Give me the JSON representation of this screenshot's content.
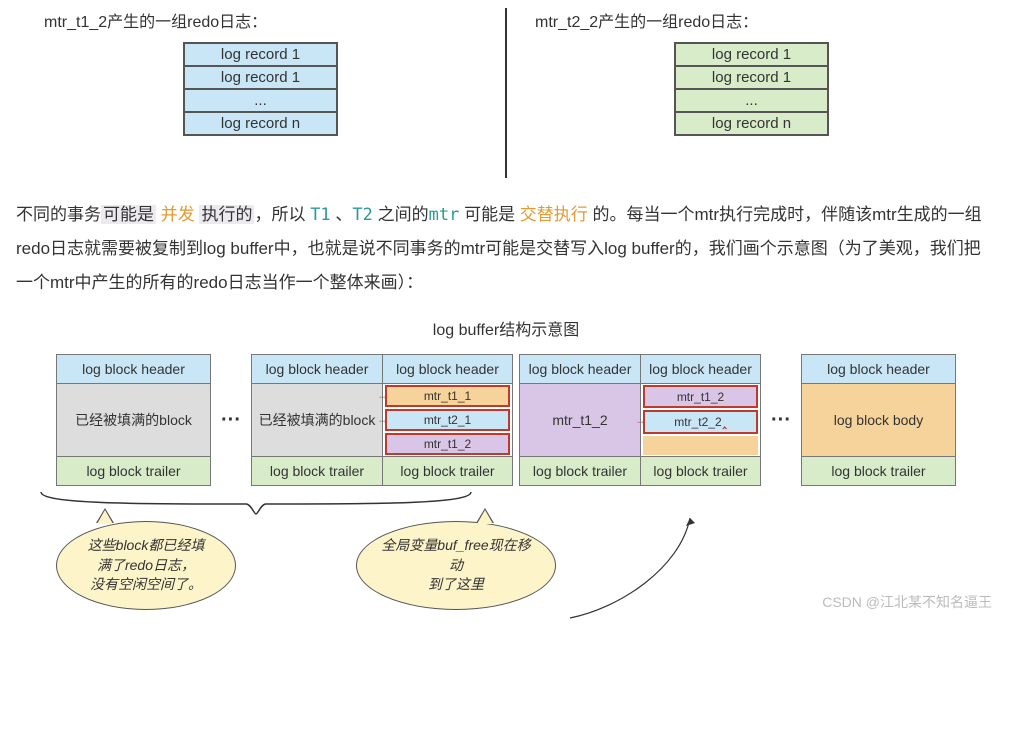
{
  "top": {
    "left_title": "mtr_t1_2产生的一组redo日志：",
    "right_title": "mtr_t2_2产生的一组redo日志：",
    "rows": [
      "log record 1",
      "log record 1",
      "...",
      "log record n"
    ]
  },
  "paragraph": {
    "p1a": "不同的事务",
    "p1b_hl": "可能是",
    "p1c_orange": " 并发 ",
    "p1d_hl": "执行的",
    "p1e": "，所以 ",
    "t1": "T1",
    "sep": " 、",
    "t2": "T2",
    "p1f": " 之间的",
    "mtr": "mtr",
    "p1g": " 可能是 ",
    "p1h_orange": "交替执行",
    "p1i": " 的。每当一个mtr执行完成时，伴随该mtr生成的一组redo日志就需要被复制到log buffer中，也就是说不同事务的mtr可能是交替写入log buffer的，我们画个示意图（为了美观，我们把一个mtr中产生的所有的redo日志当作一个整体来画）："
  },
  "fig_title": "log buffer结构示意图",
  "labels": {
    "hdr": "log block header",
    "trl": "log block trailer",
    "body_full": "已经被填满的block",
    "body_name": "log block body",
    "mtr_t1_1": "mtr_t1_1",
    "mtr_t2_1": "mtr_t2_1",
    "mtr_t1_2": "mtr_t1_2",
    "mtr_t2_2": "mtr_t2_2",
    "mtr_t2_2_cursor": "mtr_t2_2"
  },
  "bubbles": {
    "b1_l1": "这些block都已经填",
    "b1_l2": "满了redo日志，",
    "b1_l3": "没有空闲空间了。",
    "b2_l1": "全局变量buf_free现在移动",
    "b2_l2": "到了这里"
  },
  "watermark": "CSDN @江北某不知名逼王"
}
